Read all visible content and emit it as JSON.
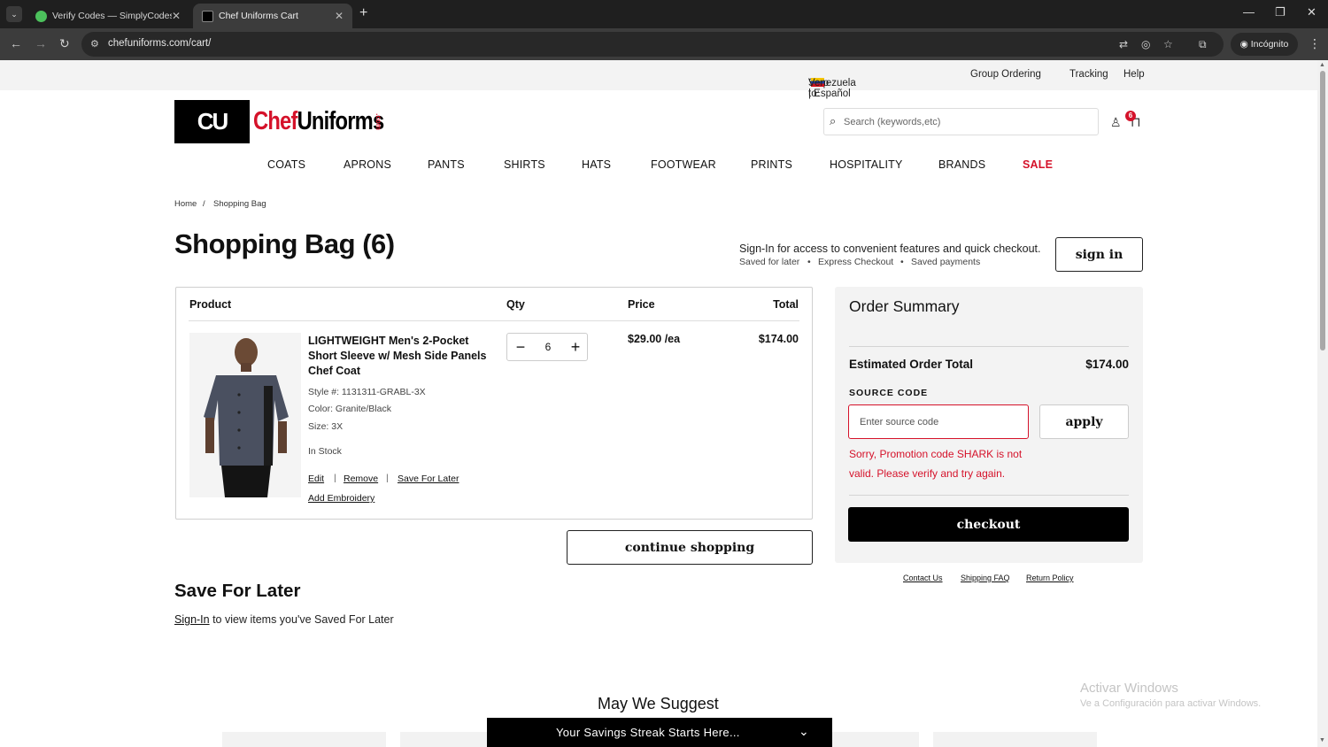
{
  "browser": {
    "tabs": [
      {
        "title": "Verify Codes — SimplyCodes"
      },
      {
        "title": "Chef Uniforms Cart"
      }
    ],
    "url": "chefuniforms.com/cart/",
    "incognito_label": "Incógnito"
  },
  "topstrip": {
    "ship_to_label": "Ship to:",
    "country": "Venezuela | Español",
    "group_ordering": "Group Ordering",
    "tracking": "Tracking",
    "help": "Help"
  },
  "header": {
    "logo_mark": "CU",
    "logo_chef": "Chef",
    "logo_uniforms": "Uniforms",
    "logo_com": ".com",
    "search_placeholder": "Search (keywords,etc)",
    "bag_count": "6"
  },
  "nav": [
    "COATS",
    "APRONS",
    "PANTS",
    "SHIRTS",
    "HATS",
    "FOOTWEAR",
    "PRINTS",
    "HOSPITALITY",
    "BRANDS",
    "SALE"
  ],
  "breadcrumb": {
    "home": "Home",
    "sep": "/",
    "current": "Shopping Bag"
  },
  "page_title": "Shopping Bag (6)",
  "signin_prompt": {
    "message": "Sign-In for access to convenient features and quick checkout.",
    "features": [
      "Saved for later",
      "Express Checkout",
      "Saved payments"
    ],
    "bullet": "•",
    "button": "sign in"
  },
  "cart": {
    "headers": {
      "product": "Product",
      "qty": "Qty",
      "price": "Price",
      "total": "Total"
    },
    "items": [
      {
        "name": "LIGHTWEIGHT Men's 2-Pocket Short Sleeve w/ Mesh Side Panels Chef Coat",
        "style": "Style #: 1131311-GRABL-3X",
        "color": "Color:  Granite/Black",
        "size": "Size:  3X",
        "stock": "In Stock",
        "qty": "6",
        "price": "$29.00 /ea",
        "total": "$174.00",
        "links": {
          "edit": "Edit",
          "remove": "Remove",
          "save_for_later": "Save For Later",
          "add_embroidery": "Add Embroidery"
        }
      }
    ],
    "continue_label": "continue shopping"
  },
  "summary": {
    "title": "Order Summary",
    "estimated_label": "Estimated Order Total",
    "estimated_value": "$174.00",
    "source_code_label": "SOURCE CODE",
    "source_placeholder": "Enter source code",
    "apply_label": "apply",
    "error": "Sorry, Promotion code SHARK is not valid. Please verify and try again.",
    "checkout_label": "checkout",
    "footer_links": [
      "Contact Us",
      "Shipping FAQ",
      "Return Policy"
    ]
  },
  "save_for_later": {
    "title": "Save For Later",
    "link": "Sign-In",
    "text": " to view items you've Saved For Later"
  },
  "suggest_title": "May We Suggest",
  "promo_bar": "Your Savings Streak Starts Here...",
  "watermark": {
    "line1": "Activar Windows",
    "line2": "Ve a Configuración para activar Windows."
  },
  "colors": {
    "brand_red": "#d5122a",
    "black": "#000000"
  }
}
